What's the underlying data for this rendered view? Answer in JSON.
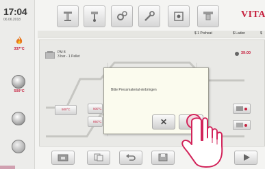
{
  "status": {
    "time": "17:04",
    "date": "06.06.2018",
    "temp_top": "337°C",
    "temp_mid": "500°C"
  },
  "brand": "VITA",
  "tabs": [
    "$ 1 Preheat",
    "$ Laden",
    "$"
  ],
  "program": {
    "name": "PM 8",
    "subtitle": "3 bar - 1 Pellet",
    "timer": "39:00"
  },
  "side_buttons": {
    "temp_left": "500°C",
    "temp_label_1": "500°C",
    "temp_label_2": "850°C"
  },
  "dialog": {
    "message": "Bitte Pressmaterial einbringen",
    "cancel_label": "✕"
  },
  "colors": {
    "accent": "#c6203e",
    "dialog_bg": "#fbfbee",
    "hand_outline": "#d2235a"
  },
  "icons": [
    "flame-icon",
    "clock-icon",
    "home-icon",
    "play-icon",
    "undo-icon",
    "check-icon"
  ]
}
